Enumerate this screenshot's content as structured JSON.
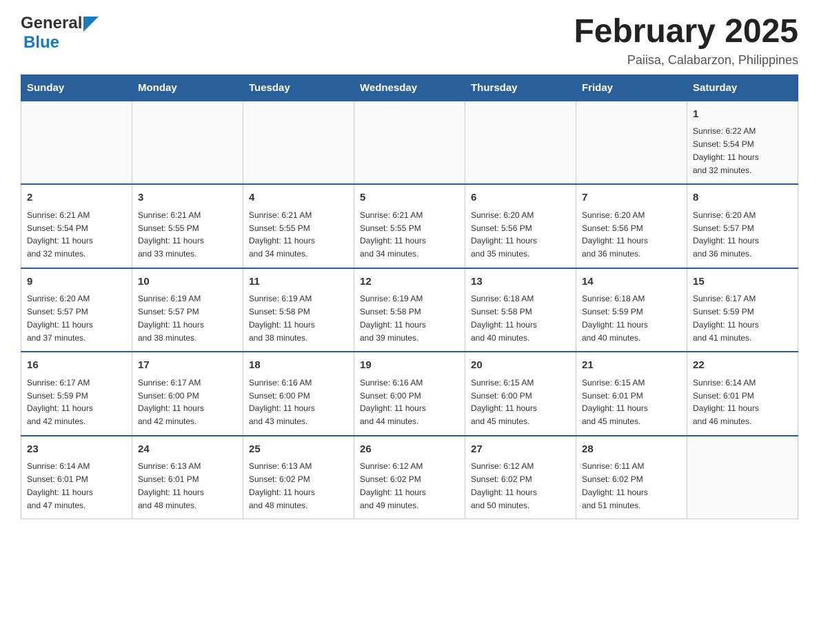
{
  "logo": {
    "general": "General",
    "blue": "Blue"
  },
  "header": {
    "title": "February 2025",
    "location": "Paiisa, Calabarzon, Philippines"
  },
  "days_of_week": [
    "Sunday",
    "Monday",
    "Tuesday",
    "Wednesday",
    "Thursday",
    "Friday",
    "Saturday"
  ],
  "weeks": [
    {
      "cells": [
        {
          "day": "",
          "info": ""
        },
        {
          "day": "",
          "info": ""
        },
        {
          "day": "",
          "info": ""
        },
        {
          "day": "",
          "info": ""
        },
        {
          "day": "",
          "info": ""
        },
        {
          "day": "",
          "info": ""
        },
        {
          "day": "1",
          "info": "Sunrise: 6:22 AM\nSunset: 5:54 PM\nDaylight: 11 hours\nand 32 minutes."
        }
      ]
    },
    {
      "cells": [
        {
          "day": "2",
          "info": "Sunrise: 6:21 AM\nSunset: 5:54 PM\nDaylight: 11 hours\nand 32 minutes."
        },
        {
          "day": "3",
          "info": "Sunrise: 6:21 AM\nSunset: 5:55 PM\nDaylight: 11 hours\nand 33 minutes."
        },
        {
          "day": "4",
          "info": "Sunrise: 6:21 AM\nSunset: 5:55 PM\nDaylight: 11 hours\nand 34 minutes."
        },
        {
          "day": "5",
          "info": "Sunrise: 6:21 AM\nSunset: 5:55 PM\nDaylight: 11 hours\nand 34 minutes."
        },
        {
          "day": "6",
          "info": "Sunrise: 6:20 AM\nSunset: 5:56 PM\nDaylight: 11 hours\nand 35 minutes."
        },
        {
          "day": "7",
          "info": "Sunrise: 6:20 AM\nSunset: 5:56 PM\nDaylight: 11 hours\nand 36 minutes."
        },
        {
          "day": "8",
          "info": "Sunrise: 6:20 AM\nSunset: 5:57 PM\nDaylight: 11 hours\nand 36 minutes."
        }
      ]
    },
    {
      "cells": [
        {
          "day": "9",
          "info": "Sunrise: 6:20 AM\nSunset: 5:57 PM\nDaylight: 11 hours\nand 37 minutes."
        },
        {
          "day": "10",
          "info": "Sunrise: 6:19 AM\nSunset: 5:57 PM\nDaylight: 11 hours\nand 38 minutes."
        },
        {
          "day": "11",
          "info": "Sunrise: 6:19 AM\nSunset: 5:58 PM\nDaylight: 11 hours\nand 38 minutes."
        },
        {
          "day": "12",
          "info": "Sunrise: 6:19 AM\nSunset: 5:58 PM\nDaylight: 11 hours\nand 39 minutes."
        },
        {
          "day": "13",
          "info": "Sunrise: 6:18 AM\nSunset: 5:58 PM\nDaylight: 11 hours\nand 40 minutes."
        },
        {
          "day": "14",
          "info": "Sunrise: 6:18 AM\nSunset: 5:59 PM\nDaylight: 11 hours\nand 40 minutes."
        },
        {
          "day": "15",
          "info": "Sunrise: 6:17 AM\nSunset: 5:59 PM\nDaylight: 11 hours\nand 41 minutes."
        }
      ]
    },
    {
      "cells": [
        {
          "day": "16",
          "info": "Sunrise: 6:17 AM\nSunset: 5:59 PM\nDaylight: 11 hours\nand 42 minutes."
        },
        {
          "day": "17",
          "info": "Sunrise: 6:17 AM\nSunset: 6:00 PM\nDaylight: 11 hours\nand 42 minutes."
        },
        {
          "day": "18",
          "info": "Sunrise: 6:16 AM\nSunset: 6:00 PM\nDaylight: 11 hours\nand 43 minutes."
        },
        {
          "day": "19",
          "info": "Sunrise: 6:16 AM\nSunset: 6:00 PM\nDaylight: 11 hours\nand 44 minutes."
        },
        {
          "day": "20",
          "info": "Sunrise: 6:15 AM\nSunset: 6:00 PM\nDaylight: 11 hours\nand 45 minutes."
        },
        {
          "day": "21",
          "info": "Sunrise: 6:15 AM\nSunset: 6:01 PM\nDaylight: 11 hours\nand 45 minutes."
        },
        {
          "day": "22",
          "info": "Sunrise: 6:14 AM\nSunset: 6:01 PM\nDaylight: 11 hours\nand 46 minutes."
        }
      ]
    },
    {
      "cells": [
        {
          "day": "23",
          "info": "Sunrise: 6:14 AM\nSunset: 6:01 PM\nDaylight: 11 hours\nand 47 minutes."
        },
        {
          "day": "24",
          "info": "Sunrise: 6:13 AM\nSunset: 6:01 PM\nDaylight: 11 hours\nand 48 minutes."
        },
        {
          "day": "25",
          "info": "Sunrise: 6:13 AM\nSunset: 6:02 PM\nDaylight: 11 hours\nand 48 minutes."
        },
        {
          "day": "26",
          "info": "Sunrise: 6:12 AM\nSunset: 6:02 PM\nDaylight: 11 hours\nand 49 minutes."
        },
        {
          "day": "27",
          "info": "Sunrise: 6:12 AM\nSunset: 6:02 PM\nDaylight: 11 hours\nand 50 minutes."
        },
        {
          "day": "28",
          "info": "Sunrise: 6:11 AM\nSunset: 6:02 PM\nDaylight: 11 hours\nand 51 minutes."
        },
        {
          "day": "",
          "info": ""
        }
      ]
    }
  ]
}
